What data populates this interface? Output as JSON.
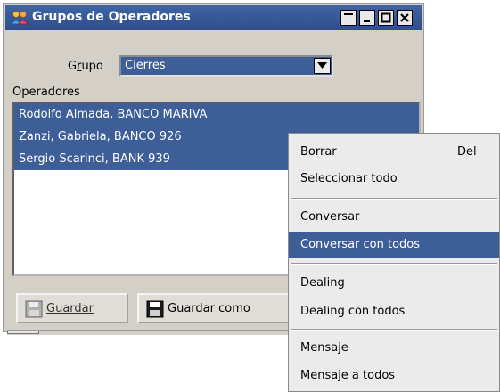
{
  "window": {
    "title": "Grupos de Operadores",
    "icon": "people-icon",
    "controls": [
      "shade-icon",
      "minimize-icon",
      "maximize-icon",
      "close-icon"
    ],
    "colors": {
      "titlebar": "#3f64a5",
      "selection": "#3e5e98",
      "face": "#d4d0c8"
    }
  },
  "form": {
    "grupo_label": "Grupo",
    "grupo_value": "Cierres",
    "operadores_label": "Operadores",
    "operadores": [
      "Rodolfo Almada, BANCO MARIVA",
      "Zanzi, Gabriela, BANCO 926",
      "Sergio Scarinci, BANK 939"
    ]
  },
  "buttons": {
    "guardar": "Guardar",
    "guardar_como": "Guardar como"
  },
  "context_menu": {
    "items": [
      {
        "label": "Borrar",
        "shortcut": "Del"
      },
      {
        "label": "Seleccionar todo"
      },
      {
        "label": "Conversar"
      },
      {
        "label": "Conversar con todos",
        "highlighted": true
      },
      {
        "label": "Dealing"
      },
      {
        "label": "Dealing con todos"
      },
      {
        "label": "Mensaje"
      },
      {
        "label": "Mensaje a todos"
      }
    ]
  }
}
